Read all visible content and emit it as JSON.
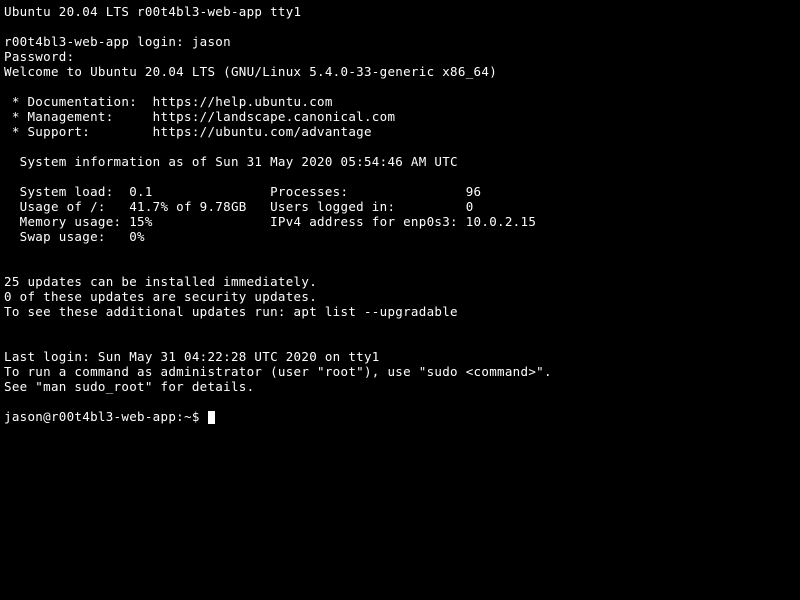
{
  "header": "Ubuntu 20.04 LTS r00t4bl3-web-app tty1",
  "login_prompt": "r00t4bl3-web-app login: jason",
  "password_prompt": "Password:",
  "welcome": "Welcome to Ubuntu 20.04 LTS (GNU/Linux 5.4.0-33-generic x86_64)",
  "links": {
    "doc": " * Documentation:  https://help.ubuntu.com",
    "mgmt": " * Management:     https://landscape.canonical.com",
    "support": " * Support:        https://ubuntu.com/advantage"
  },
  "sysinfo_header": "  System information as of Sun 31 May 2020 05:54:46 AM UTC",
  "sysinfo": {
    "r1": "  System load:  0.1               Processes:               96",
    "r2": "  Usage of /:   41.7% of 9.78GB   Users logged in:         0",
    "r3": "  Memory usage: 15%               IPv4 address for enp0s3: 10.0.2.15",
    "r4": "  Swap usage:   0%"
  },
  "updates": {
    "l1": "25 updates can be installed immediately.",
    "l2": "0 of these updates are security updates.",
    "l3": "To see these additional updates run: apt list --upgradable"
  },
  "lastlogin": "Last login: Sun May 31 04:22:28 UTC 2020 on tty1",
  "sudo1": "To run a command as administrator (user \"root\"), use \"sudo <command>\".",
  "sudo2": "See \"man sudo_root\" for details.",
  "prompt": "jason@r00t4bl3-web-app:~$ "
}
